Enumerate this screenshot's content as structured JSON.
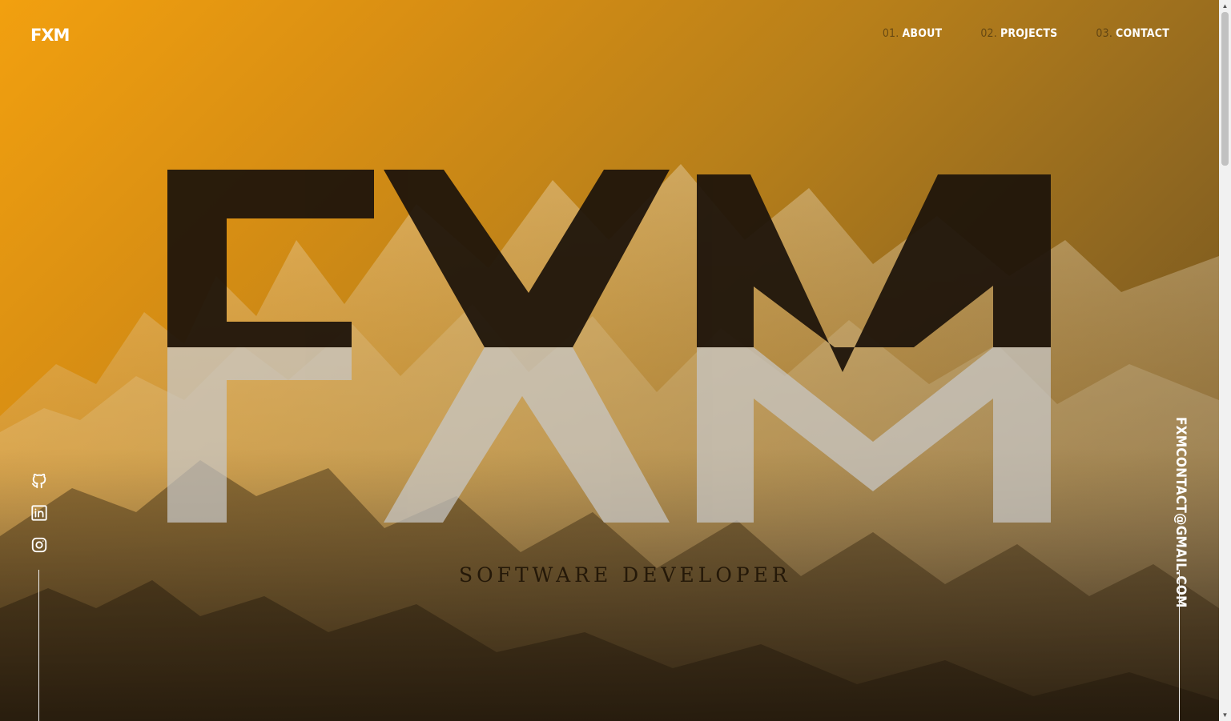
{
  "brand": {
    "logo_text": "FXM"
  },
  "nav": [
    {
      "number": "01.",
      "label": "ABOUT"
    },
    {
      "number": "02.",
      "label": "PROJECTS"
    },
    {
      "number": "03.",
      "label": "CONTACT"
    }
  ],
  "hero": {
    "headline": "FXM",
    "subtitle": "SOFTWARE DEVELOPER"
  },
  "social": [
    {
      "icon": "github-icon"
    },
    {
      "icon": "linkedin-icon"
    },
    {
      "icon": "instagram-icon"
    }
  ],
  "contact": {
    "email": "FXMCONTACT@GMAIL.COM"
  },
  "colors": {
    "accent": "#f2a00f",
    "dark_text": "#1e140b",
    "light_letters": "#c7c7c7",
    "white": "#ffffff"
  },
  "scrollbar": {
    "up_arrow": "▲",
    "down_arrow": "▼"
  }
}
